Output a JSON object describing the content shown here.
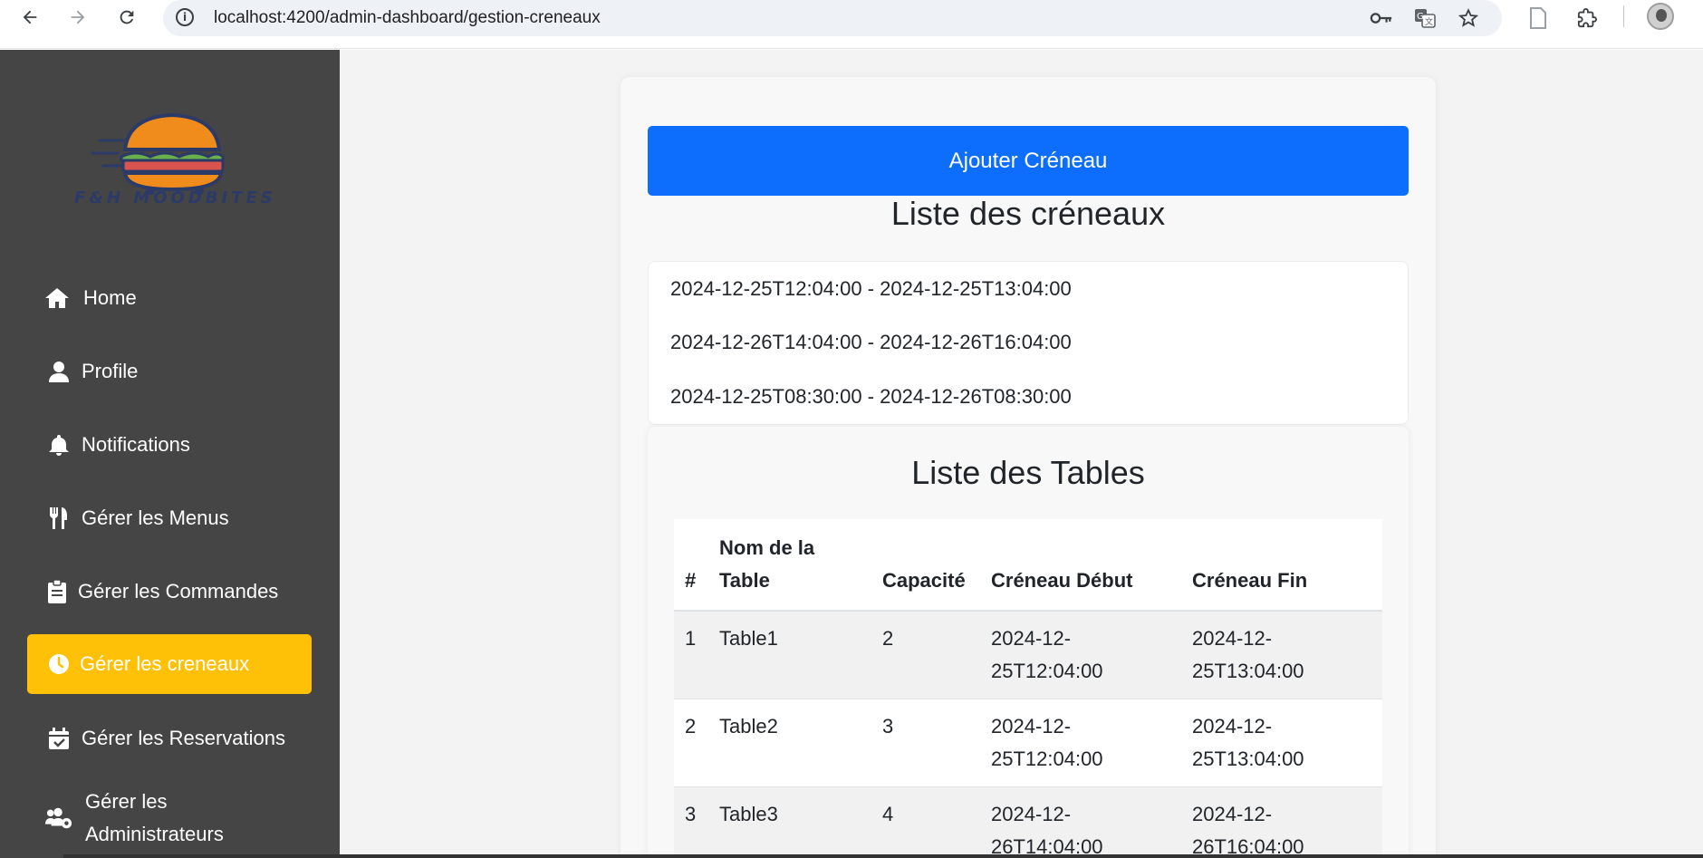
{
  "browser": {
    "url": "localhost:4200/admin-dashboard/gestion-creneaux"
  },
  "sidebar": {
    "logo_text": "F&H MOODBITES",
    "items": [
      {
        "label": "Home",
        "icon": "home-icon"
      },
      {
        "label": "Profile",
        "icon": "user-icon"
      },
      {
        "label": "Notifications",
        "icon": "bell-icon"
      },
      {
        "label": "Gérer les Menus",
        "icon": "utensils-icon"
      },
      {
        "label": "Gérer les Commandes",
        "icon": "clipboard-icon"
      },
      {
        "label": "Gérer les creneaux",
        "icon": "clock-icon",
        "active": true
      },
      {
        "label": "Gérer les Reservations",
        "icon": "calendar-check-icon"
      },
      {
        "label": "Gérer les Administrateurs",
        "label_line1": "Gérer les",
        "label_line2": "Administrateurs",
        "icon": "users-cog-icon"
      }
    ]
  },
  "main": {
    "add_button": "Ajouter Créneau",
    "slots_title": "Liste des créneaux",
    "slots": [
      "2024-12-25T12:04:00 - 2024-12-25T13:04:00",
      "2024-12-26T14:04:00 - 2024-12-26T16:04:00",
      "2024-12-25T08:30:00 - 2024-12-26T08:30:00"
    ],
    "tables_title": "Liste des Tables",
    "table": {
      "headers": {
        "num": "#",
        "name_line1": "Nom de la",
        "name_line2": "Table",
        "capacity": "Capacité",
        "start": "Créneau Début",
        "end": "Créneau Fin"
      },
      "rows": [
        {
          "num": "1",
          "name": "Table1",
          "capacity": "2",
          "start_1": "2024-12-",
          "start_2": "25T12:04:00",
          "end_1": "2024-12-",
          "end_2": "25T13:04:00"
        },
        {
          "num": "2",
          "name": "Table2",
          "capacity": "3",
          "start_1": "2024-12-",
          "start_2": "25T12:04:00",
          "end_1": "2024-12-",
          "end_2": "25T13:04:00"
        },
        {
          "num": "3",
          "name": "Table3",
          "capacity": "4",
          "start_1": "2024-12-",
          "start_2": "26T14:04:00",
          "end_1": "2024-12-",
          "end_2": "26T16:04:00"
        }
      ]
    }
  },
  "colors": {
    "sidebar_bg": "#454545",
    "active_item": "#ffc107",
    "primary_button": "#0d6efd"
  }
}
